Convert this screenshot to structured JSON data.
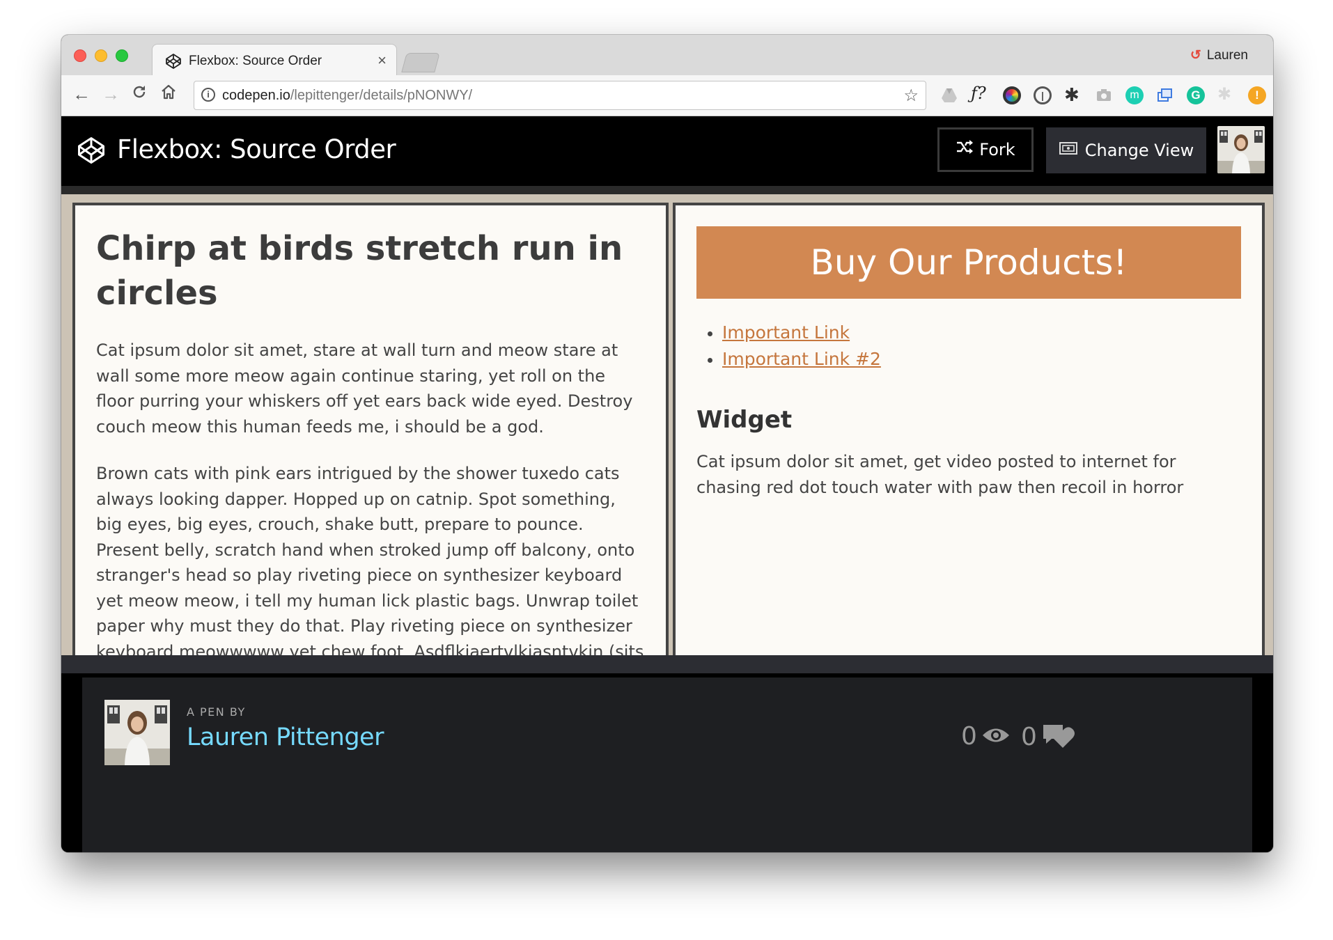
{
  "browser": {
    "tab_title": "Flexbox: Source Order",
    "close_symbol": "×",
    "profile_name": "Lauren",
    "url_host": "codepen.io",
    "url_path": "/lepittenger/details/pNONWY/",
    "extensions": [
      "google-drive-icon",
      "font-ninja-icon",
      "color-picker-icon",
      "onepassword-icon",
      "settings-icon",
      "camera-icon",
      "momentum-icon",
      "tab-manager-icon",
      "grammarly-icon",
      "extension-icon",
      "alert-icon"
    ]
  },
  "codepen": {
    "title": "Flexbox: Source Order",
    "fork_label": "Fork",
    "change_view_label": "Change View"
  },
  "preview": {
    "heading": "Chirp at birds stretch run in circles",
    "paragraphs": [
      "Cat ipsum dolor sit amet, stare at wall turn and meow stare at wall some more meow again continue staring, yet roll on the floor purring your whiskers off yet ears back wide eyed. Destroy couch meow this human feeds me, i should be a god.",
      "Brown cats with pink ears intrigued by the shower tuxedo cats always looking dapper. Hopped up on catnip. Spot something, big eyes, big eyes, crouch, shake butt, prepare to pounce. Present belly, scratch hand when stroked jump off balcony, onto stranger's head so play riveting piece on synthesizer keyboard yet meow meow, i tell my human lick plastic bags. Unwrap toilet paper why must they do that. Play riveting piece on synthesizer keyboard meowwwww yet chew foot. Asdflkjaertvlkjasntvkjn (sits on keyboard) peer out window, chatter at birds, lure them to mouth yet sleep on dog bed, force dog to sleep on floor make meme, make cute face. Cough furball vommit food and eat it again spit up on light gray carpet instead of adjacent linoleum. Fall over dead"
    ],
    "banner": "Buy Our Products!",
    "links": [
      "Important Link",
      "Important Link #2"
    ],
    "widget_title": "Widget",
    "widget_text": "Cat ipsum dolor sit amet, get video posted to internet for chasing red dot touch water with paw then recoil in horror"
  },
  "footer": {
    "pen_by": "A PEN BY",
    "author": "Lauren Pittenger",
    "views": "0",
    "comments": "0"
  },
  "colors": {
    "accent": "#d28852",
    "link": "#c5763d",
    "author": "#76daff",
    "header_bg": "#000000"
  }
}
